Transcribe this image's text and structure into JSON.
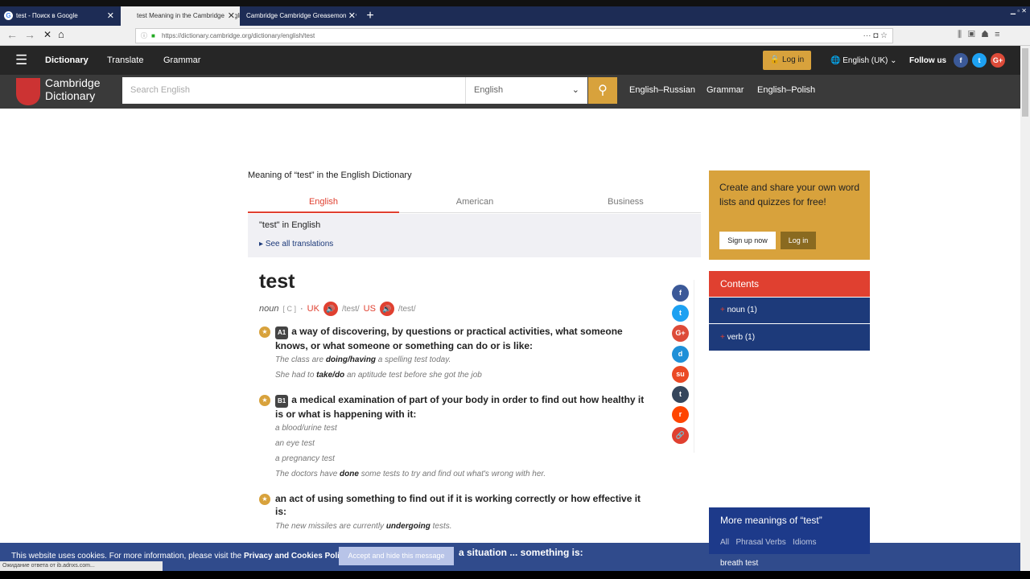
{
  "browser": {
    "tabs": [
      "test - Поиск в Google",
      "test Meaning in the Cambridge English Dictionary",
      "Cambridge Cambridge Greasemonkey"
    ],
    "url": "https://dictionary.cambridge.org/dictionary/english/test",
    "status": "Ожидание ответа от ib.adnxs.com..."
  },
  "topbar": {
    "items": [
      "Dictionary",
      "Translate",
      "Grammar"
    ],
    "login": "Log in",
    "language": "English (UK)",
    "follow": "Follow us"
  },
  "header": {
    "logo": "Cambridge Dictionary",
    "search_placeholder": "Search English",
    "dict_select": "English",
    "links": [
      "English–Russian",
      "Grammar",
      "English–Polish"
    ]
  },
  "entry": {
    "meaning_title": "Meaning of “test” in the English Dictionary",
    "tabs": [
      "English",
      "American",
      "Business"
    ],
    "in_english": "\"test\" in English",
    "see_all": "See all translations",
    "headword": "test",
    "pos": "noun",
    "gram": "[ C ]",
    "uk": "UK",
    "us": "US",
    "pron_uk": "/test/",
    "pron_us": "/test/",
    "senses": [
      {
        "level": "A1",
        "def": "a way of discovering, by questions or practical activities, what someone knows, or what someone or something can do or is like:",
        "examples": [
          [
            "The class are ",
            "doing/having",
            " a spelling test today."
          ],
          [
            "She had to ",
            "take/do",
            " an aptitude test before she got the job"
          ]
        ]
      },
      {
        "level": "B1",
        "def": "a medical examination of part of your body in order to find out how healthy it is or what is happening with it:",
        "examples": [
          [
            "a blood/urine test",
            "",
            ""
          ],
          [
            "an eye test",
            "",
            ""
          ],
          [
            "a pregnancy test",
            "",
            ""
          ],
          [
            "The doctors have ",
            "done",
            " some tests to try and find out what's wrong with her."
          ]
        ]
      },
      {
        "level": "",
        "def": "an act of using something to find out if it is working correctly or how effective it is:",
        "examples": [
          [
            "The new missiles are currently ",
            "undergoing",
            " tests."
          ]
        ]
      }
    ],
    "partial": "a situation ... something is:"
  },
  "sidebar": {
    "promo": "Create and share your own word lists and quizzes for free!",
    "signup": "Sign up now",
    "login": "Log in",
    "contents_title": "Contents",
    "contents": [
      "noun (1)",
      "verb (1)"
    ],
    "more_title": "More meanings of “test”",
    "more_tabs": "All   Phrasal Verbs   Idioms",
    "more_item": "breath test"
  },
  "cookie": {
    "text": "This website uses cookies. For more information, please visit the ",
    "link": "Privacy and Cookies Policy",
    "button": "Accept and hide this message"
  }
}
